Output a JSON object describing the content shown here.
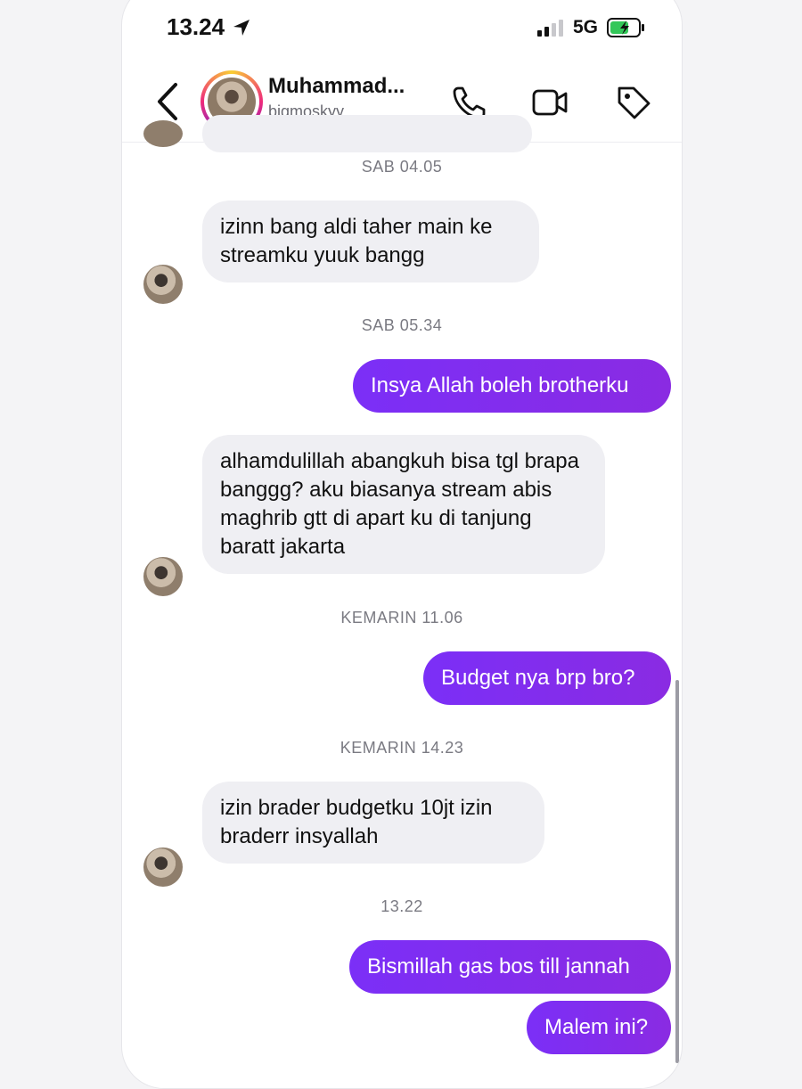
{
  "status_bar": {
    "time": "13.24",
    "network": "5G"
  },
  "header": {
    "name": "Muhammad...",
    "handle": "bigmoskyy"
  },
  "messages": [
    {
      "type": "stamp",
      "text": "SAB 04.05"
    },
    {
      "type": "in",
      "text": "izinn bang aldi taher main ke streamku yuuk bangg"
    },
    {
      "type": "stamp",
      "text": "SAB 05.34"
    },
    {
      "type": "out",
      "text": "Insya Allah boleh brotherku"
    },
    {
      "type": "in",
      "text": "alhamdulillah abangkuh bisa tgl brapa banggg? aku biasanya stream abis maghrib gtt di apart ku di tanjung baratt jakarta"
    },
    {
      "type": "stamp",
      "text": "KEMARIN 11.06"
    },
    {
      "type": "out",
      "text": "Budget nya brp bro?"
    },
    {
      "type": "stamp",
      "text": "KEMARIN 14.23"
    },
    {
      "type": "in",
      "text": "izin brader budgetku 10jt izin braderr insyallah"
    },
    {
      "type": "stamp",
      "text": "13.22"
    },
    {
      "type": "out",
      "text": "Bismillah gas bos till jannah"
    },
    {
      "type": "out",
      "text": "Malem ini?"
    }
  ],
  "colors": {
    "accent": "#7b2ff7",
    "incoming": "#efeff3"
  }
}
